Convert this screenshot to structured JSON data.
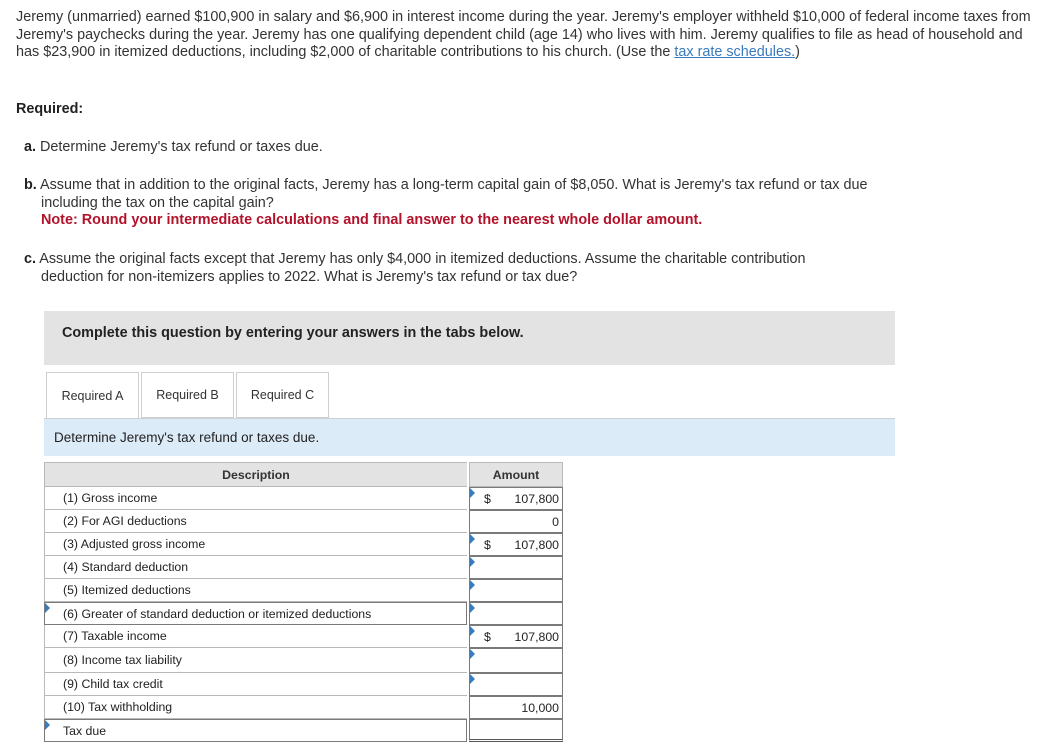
{
  "intro": {
    "text_before_link": "Jeremy (unmarried) earned $100,900 in salary and $6,900 in interest income during the year. Jeremy's employer withheld $10,000 of federal income taxes from Jeremy's paychecks during the year. Jeremy has one qualifying dependent child (age 14) who lives with him. Jeremy qualifies to file as head of household and has $23,900 in itemized deductions, including $2,000 of charitable contributions to his church. (Use the ",
    "link_text": "tax rate schedules.",
    "text_after_link": ")"
  },
  "required_heading": "Required:",
  "parts": {
    "a": {
      "letter": "a.",
      "text": "Determine Jeremy's tax refund or taxes due."
    },
    "b": {
      "letter": "b.",
      "line1": "Assume that in addition to the original facts, Jeremy has a long-term capital gain of $8,050. What is Jeremy's tax refund or tax due",
      "line2": "including the tax on the capital gain?",
      "note": "Note: Round your intermediate calculations and final answer to the nearest whole dollar amount."
    },
    "c": {
      "letter": "c.",
      "line1": "Assume the original facts except that Jeremy has only $4,000 in itemized deductions. Assume the charitable contribution",
      "line2": "deduction for non-itemizers applies to 2022. What is Jeremy's tax refund or tax due?"
    }
  },
  "instruction_box": "Complete this question by entering your answers in the tabs below.",
  "tabs": [
    {
      "label": "Required A",
      "active": true
    },
    {
      "label": "Required B",
      "active": false
    },
    {
      "label": "Required C",
      "active": false
    }
  ],
  "panel_heading": "Determine Jeremy's tax refund or taxes due.",
  "table": {
    "headers": {
      "description": "Description",
      "amount": "Amount"
    },
    "rows": [
      {
        "label": "(1) Gross income",
        "dollar": "$",
        "value": "107,800"
      },
      {
        "label": "(2) For AGI deductions",
        "dollar": "",
        "value": "0"
      },
      {
        "label": "(3) Adjusted gross income",
        "dollar": "$",
        "value": "107,800"
      },
      {
        "label": "(4) Standard deduction",
        "dollar": "",
        "value": ""
      },
      {
        "label": "(5) Itemized deductions",
        "dollar": "",
        "value": ""
      },
      {
        "label": "(6) Greater of standard deduction or itemized deductions",
        "dollar": "",
        "value": ""
      },
      {
        "label": "(7) Taxable income",
        "dollar": "$",
        "value": "107,800"
      },
      {
        "label": "(8) Income tax liability",
        "dollar": "",
        "value": ""
      },
      {
        "label": "(9) Child tax credit",
        "dollar": "",
        "value": ""
      },
      {
        "label": "(10) Tax withholding",
        "dollar": "",
        "value": "10,000"
      },
      {
        "label": "Tax due",
        "dollar": "",
        "value": ""
      }
    ]
  },
  "colors": {
    "link": "#3a7bbd",
    "note": "#b3122b",
    "panel_bg": "#dcebf8",
    "header_bg": "#e3e3e3"
  }
}
